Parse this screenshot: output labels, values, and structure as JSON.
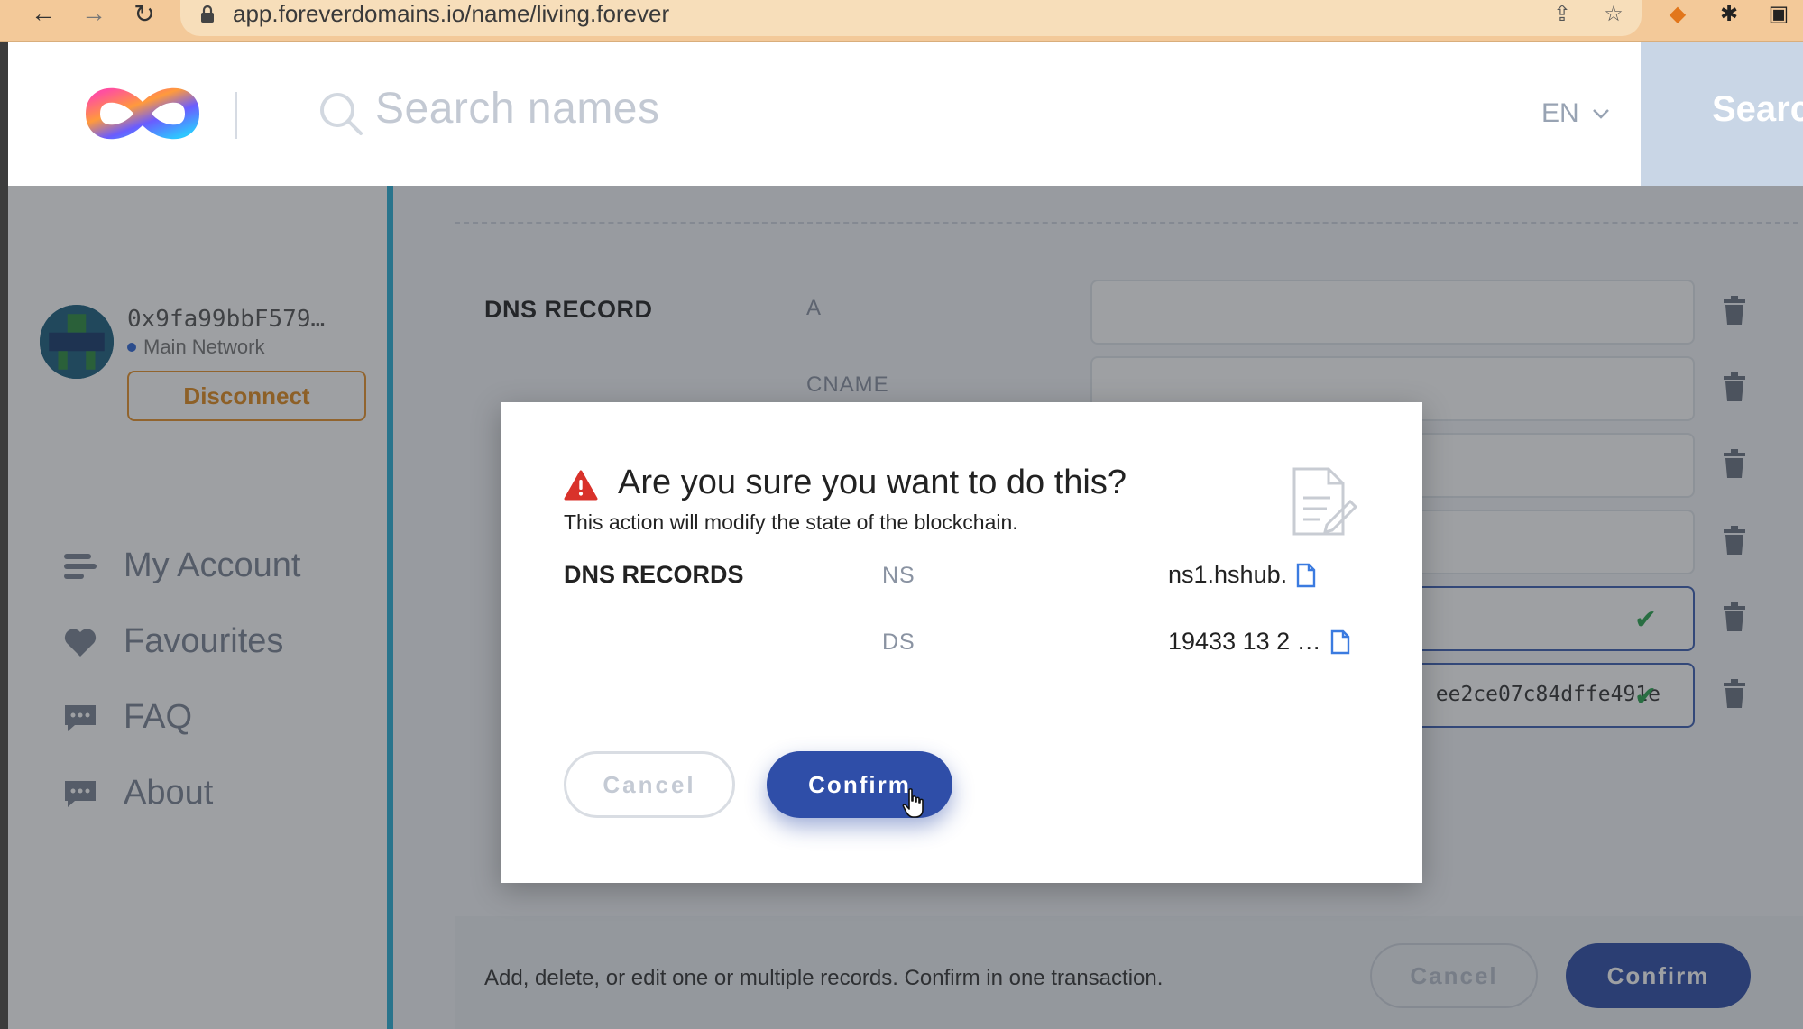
{
  "browser": {
    "url": "app.foreverdomains.io/name/living.forever"
  },
  "header": {
    "search_placeholder": "Search names",
    "language": "EN",
    "search_button": "Search"
  },
  "sidebar": {
    "address": "0x9fa99bbF579…",
    "network": "Main Network",
    "disconnect": "Disconnect",
    "items": [
      {
        "label": "My Account",
        "icon": "list-icon"
      },
      {
        "label": "Favourites",
        "icon": "heart-icon"
      },
      {
        "label": "FAQ",
        "icon": "chat-icon"
      },
      {
        "label": "About",
        "icon": "chat-icon"
      }
    ]
  },
  "content": {
    "dns_label": "DNS RECORD",
    "records": [
      {
        "type": "A",
        "value": ""
      },
      {
        "type": "CNAME",
        "value": ""
      },
      {
        "type": "",
        "value": ""
      },
      {
        "type": "",
        "value": ""
      },
      {
        "type": "",
        "value": ""
      },
      {
        "type": "",
        "value": "ee2ce07c84dffe491e"
      }
    ],
    "footer_text": "Add, delete, or edit one or multiple records. Confirm in one transaction.",
    "cancel": "Cancel",
    "confirm": "Confirm"
  },
  "modal": {
    "title": "Are you sure you want to do this?",
    "subtitle": "This action will modify the state of the blockchain.",
    "records_label": "DNS RECORDS",
    "rows": [
      {
        "type": "NS",
        "value": "ns1.hshub."
      },
      {
        "type": "DS",
        "value": "19433 13 2 …"
      }
    ],
    "cancel": "Cancel",
    "confirm": "Confirm"
  },
  "colors": {
    "accent": "#2f4ea8",
    "warning": "#d9322b",
    "sidebar_border": "#2bb0d6",
    "disconnect": "#e8932a",
    "valid_check": "#2aa44f"
  }
}
